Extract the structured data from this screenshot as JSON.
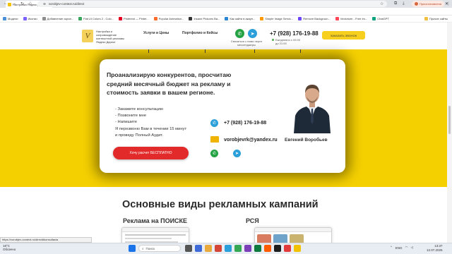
{
  "browser": {
    "tab_title": "Настройка Яндекс Директ | Vo",
    "url": "vorobjev-context.ru/direct",
    "profile_label": "Приостановлена",
    "bookmarks": [
      {
        "label": "Модели",
        "color": "#4a90d9"
      },
      {
        "label": "Иконки",
        "color": "#7b61ff"
      },
      {
        "label": "Добавление скрин...",
        "color": "#8e8e8e"
      },
      {
        "label": "Flat UI Colors 2 - Colo...",
        "color": "#3aa55d"
      },
      {
        "label": "Pinterest — Pinter...",
        "color": "#e60023"
      },
      {
        "label": "Popular Animation...",
        "color": "#ff6b2c"
      },
      {
        "label": "Insane Pictures Ba...",
        "color": "#333333"
      },
      {
        "label": "Как зайти в акаун...",
        "color": "#2b87d3"
      },
      {
        "label": "Simple Image Servic...",
        "color": "#ff9900"
      },
      {
        "label": "Remove Backgroun...",
        "color": "#6c47ff"
      },
      {
        "label": "Vectorizer - Free Im...",
        "color": "#ff4757"
      },
      {
        "label": "ChatGPT",
        "color": "#10a37f"
      }
    ],
    "bookmarks_more": "Прочие сайты"
  },
  "site_header": {
    "logo_letter": "V",
    "logo_text": "Настройка и сопровождение контекстной рекламы Яндекс Директ",
    "nav": [
      "Услуги и Цены",
      "Портфолио и Кейсы"
    ],
    "contact_note": "Связаться с нами через мессенджеры",
    "phone": "+7 (928) 176-19-88",
    "hours": "Ежедневно с 09:00 до 21:00",
    "call_button": "ЗАКАЗАТЬ ЗВОНОК"
  },
  "hero": {
    "heading": "Проанализирую конкурентов, просчитаю средний месячный бюджет на рекламу и стоимость заявки в вашем регионе.",
    "bullets": [
      "- Закажите консультацию",
      "- Позвоните мне",
      "- Напишите"
    ],
    "note_line1": "Я перезвоню Вам в течении 15 минут",
    "note_line2": "и проведу Полный Аудит.",
    "cta_label": "Хочу расчет БЕСПЛАТНО",
    "phone": "+7 (928) 176-19-88",
    "email": "vorobjevrk@yandex.ru",
    "person_name": "Евгений Воробьев"
  },
  "campaigns": {
    "title": "Основные виды рекламных кампаний",
    "col1": "Реклама на ПОИСКЕ",
    "col2": "РСЯ"
  },
  "status_url": "https://vorobjev-context.ru/direct#konsultacia",
  "taskbar": {
    "weather_temp": "18°C",
    "weather_desc": "Облачно",
    "search_placeholder": "Поиск",
    "lang": "ENG",
    "time": "13:37",
    "date": "12.07.2025"
  },
  "colors": {
    "accent_yellow": "#f5d000",
    "cta_red": "#e32a2a",
    "whatsapp_green": "#25a244",
    "telegram_blue": "#2b9fd9"
  }
}
